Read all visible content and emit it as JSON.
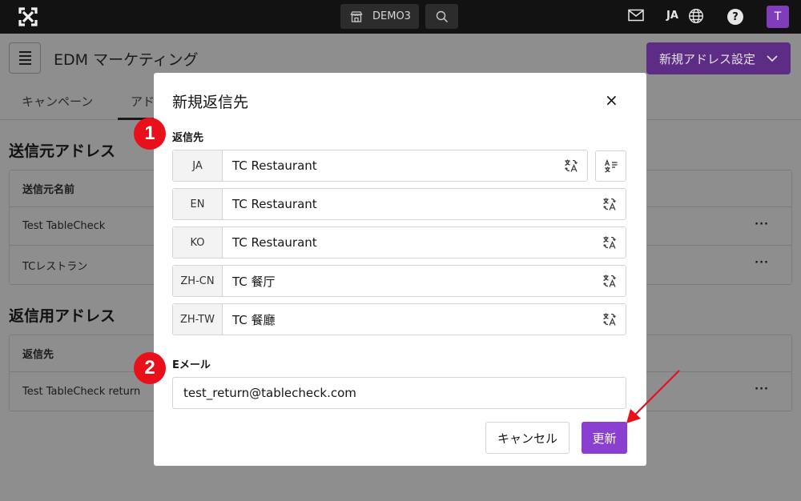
{
  "topbar": {
    "store_name": "DEMO3",
    "language": "JA",
    "help_symbol": "?",
    "avatar_initial": "T"
  },
  "page": {
    "title": "EDM マーケティング",
    "settings_button": "新規アドレス設定",
    "tabs": [
      {
        "label": "キャンペーン"
      },
      {
        "label": "アド"
      }
    ],
    "sender_section": {
      "heading": "送信元アドレス",
      "column_header": "送信元名前",
      "rows": [
        "Test TableCheck",
        "TCレストラン"
      ]
    },
    "reply_section": {
      "heading": "返信用アドレス",
      "column_header": "返信先",
      "rows": [
        "Test TableCheck return"
      ]
    },
    "row_menu": "···"
  },
  "modal": {
    "title": "新規返信先",
    "close_symbol": "×",
    "reply_label": "返信先",
    "languages": [
      {
        "code": "JA",
        "value": "TC  Restaurant"
      },
      {
        "code": "EN",
        "value": "TC Restaurant"
      },
      {
        "code": "KO",
        "value": "TC Restaurant"
      },
      {
        "code": "ZH-CN",
        "value": "TC 餐厅"
      },
      {
        "code": "ZH-TW",
        "value": "TC 餐廳"
      }
    ],
    "email_label": "Eメール",
    "email_value": "test_return@tablecheck.com",
    "cancel_label": "キャンセル",
    "update_label": "更新"
  },
  "annotations": {
    "marker_1": "1",
    "marker_2": "2"
  },
  "colors": {
    "accent": "#8a3fd1",
    "marker": "#e8101a"
  }
}
